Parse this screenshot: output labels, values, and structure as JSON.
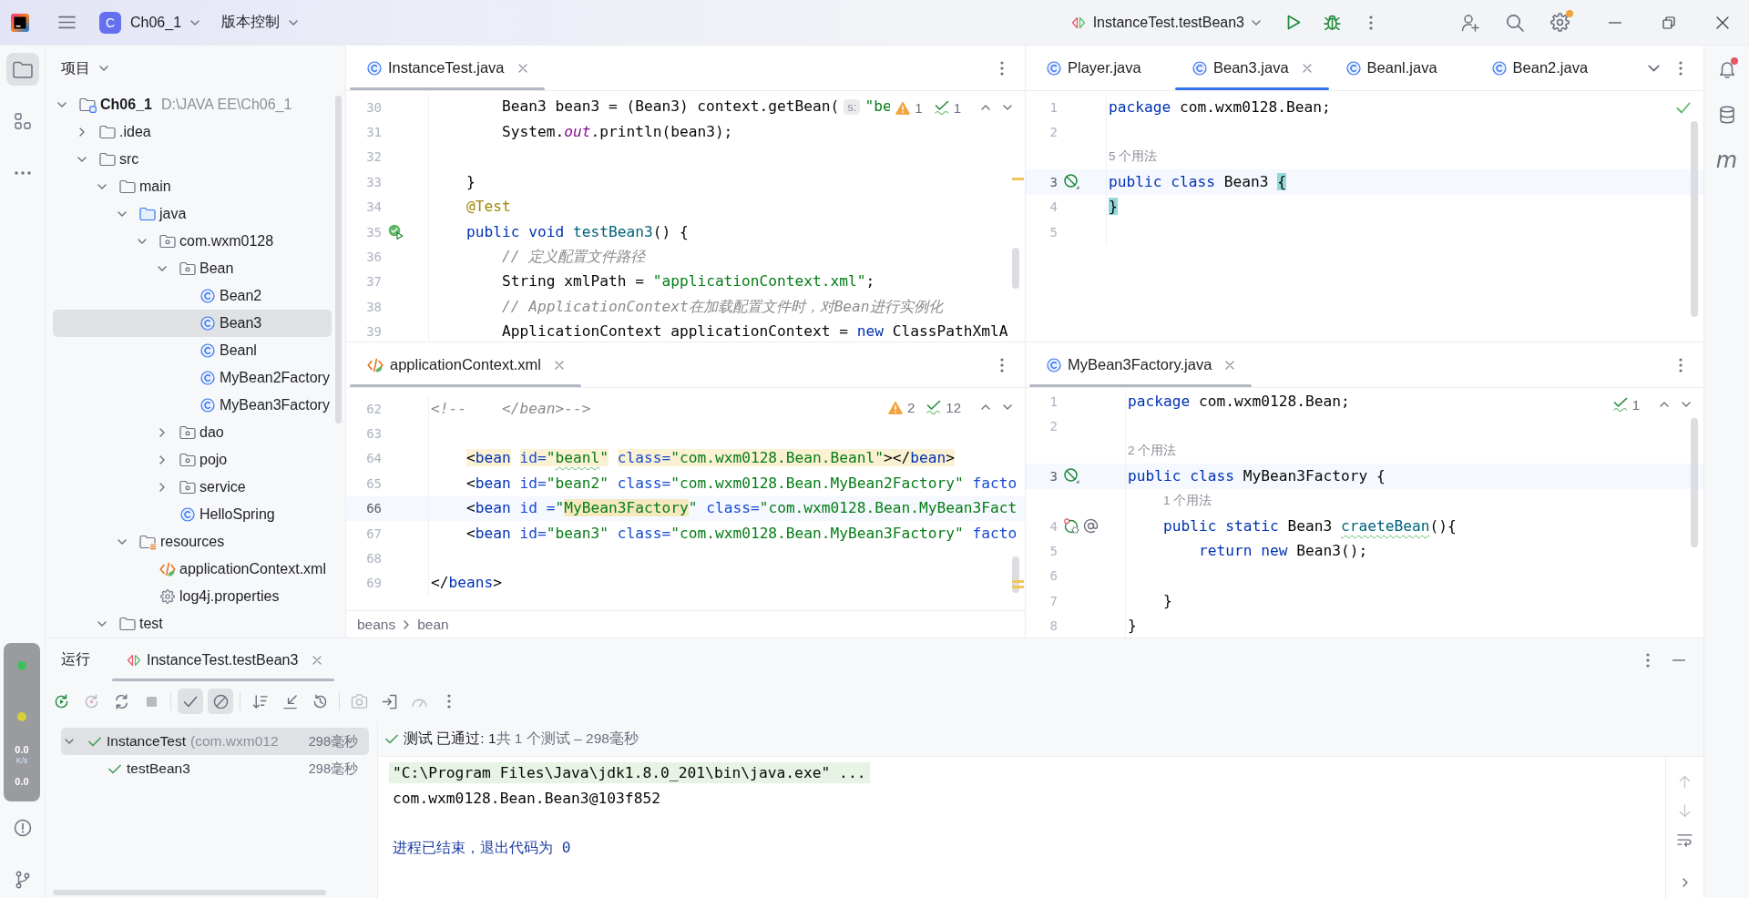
{
  "title_bar": {
    "project_badge": "C",
    "project": "Ch06_1",
    "vcs": "版本控制",
    "run_config": "InstanceTest.testBean3",
    "settings_badge": true
  },
  "tool_strip": {
    "top": [
      {
        "kind": "project",
        "selected": true
      },
      {
        "kind": "structure",
        "selected": false
      },
      {
        "kind": "more",
        "selected": false
      }
    ],
    "bottom": [
      {
        "kind": "problems",
        "selected": false
      },
      {
        "kind": "git",
        "selected": false
      }
    ]
  },
  "speed_widget": {
    "readings": [
      {
        "value": "0.0",
        "unit": "K/s"
      },
      {
        "value": "0.0"
      }
    ]
  },
  "project_panel": {
    "title": "项目",
    "tree": [
      {
        "kind": "module",
        "label": "Ch06_1",
        "hint": "D:\\JAVA EE\\Ch06_1",
        "expanded": true,
        "selected": false,
        "children": [
          {
            "kind": "folder",
            "label": ".idea",
            "expanded": false,
            "selected": false
          },
          {
            "kind": "folder",
            "label": "src",
            "expanded": true,
            "selected": false,
            "children": [
              {
                "kind": "folder",
                "label": "main",
                "expanded": true,
                "selected": false,
                "children": [
                  {
                    "kind": "source",
                    "label": "java",
                    "expanded": true,
                    "selected": false,
                    "children": [
                      {
                        "kind": "package",
                        "label": "com.wxm0128",
                        "expanded": true,
                        "selected": false,
                        "children": [
                          {
                            "kind": "package",
                            "label": "Bean",
                            "expanded": true,
                            "selected": false,
                            "children": [
                              {
                                "kind": "class",
                                "label": "Bean2",
                                "selected": false
                              },
                              {
                                "kind": "class",
                                "label": "Bean3",
                                "selected": true
                              },
                              {
                                "kind": "class",
                                "label": "Beanl",
                                "selected": false
                              },
                              {
                                "kind": "class",
                                "label": "MyBean2Factory",
                                "selected": false
                              },
                              {
                                "kind": "class",
                                "label": "MyBean3Factory",
                                "selected": false
                              }
                            ]
                          },
                          {
                            "kind": "package",
                            "label": "dao",
                            "expanded": false,
                            "selected": false
                          },
                          {
                            "kind": "package",
                            "label": "pojo",
                            "expanded": false,
                            "selected": false
                          },
                          {
                            "kind": "package",
                            "label": "service",
                            "expanded": false,
                            "selected": false
                          },
                          {
                            "kind": "class",
                            "label": "HelloSpring",
                            "selected": false
                          }
                        ]
                      }
                    ]
                  },
                  {
                    "kind": "resources",
                    "label": "resources",
                    "expanded": true,
                    "selected": false,
                    "children": [
                      {
                        "kind": "xml",
                        "label": "applicationContext.xml",
                        "selected": false
                      },
                      {
                        "kind": "properties",
                        "label": "log4j.properties",
                        "selected": false
                      }
                    ]
                  }
                ]
              },
              {
                "kind": "folder",
                "label": "test",
                "expanded": true,
                "selected": false
              }
            ]
          }
        ]
      }
    ]
  },
  "editors": [
    {
      "active": false,
      "navigation": true,
      "tabs": [
        {
          "kind": "class",
          "label": "InstanceTest.java",
          "selected": true
        }
      ],
      "inspections": [
        {
          "kind": "warning",
          "count": "1"
        },
        {
          "kind": "weak",
          "count": "1"
        }
      ],
      "lines": [
        {
          "kind": "code",
          "number": "30",
          "current": false,
          "tokens": [
            {
              "kind": "plain",
              "text": "        Bean3 bean3 = (Bean3) context.getBean("
            },
            {
              "kind": "inlay",
              "text": "s:"
            },
            {
              "kind": "string",
              "text": "\"be"
            }
          ]
        },
        {
          "kind": "code",
          "number": "31",
          "current": false,
          "tokens": [
            {
              "kind": "plain",
              "text": "        System."
            },
            {
              "kind": "field",
              "text": "out"
            },
            {
              "kind": "plain",
              "text": ".println(bean3);"
            }
          ]
        },
        {
          "kind": "code",
          "number": "32",
          "current": false
        },
        {
          "kind": "code",
          "number": "33",
          "current": false,
          "tokens": [
            {
              "kind": "plain",
              "text": "    }"
            }
          ]
        },
        {
          "kind": "code",
          "number": "34",
          "current": false,
          "tokens": [
            {
              "kind": "annotation",
              "text": "    @Test"
            }
          ]
        },
        {
          "kind": "code",
          "number": "35",
          "current": false,
          "gutter": [
            {
              "kind": "run"
            }
          ],
          "tokens": [
            {
              "kind": "keyword",
              "text": "    public void "
            },
            {
              "kind": "decl",
              "text": "testBean3"
            },
            {
              "kind": "plain",
              "text": "() {"
            }
          ]
        },
        {
          "kind": "code",
          "number": "36",
          "current": false,
          "tokens": [
            {
              "kind": "comment",
              "text": "        // 定义配置文件路径"
            }
          ]
        },
        {
          "kind": "code",
          "number": "37",
          "current": false,
          "tokens": [
            {
              "kind": "plain",
              "text": "        String xmlPath = "
            },
            {
              "kind": "string",
              "text": "\"applicationContext.xml\""
            },
            {
              "kind": "plain",
              "text": ";"
            }
          ]
        },
        {
          "kind": "code",
          "number": "38",
          "current": false,
          "tokens": [
            {
              "kind": "comment",
              "text": "        // ApplicationContext在加载配置文件时，对Bean进行实例化"
            }
          ]
        },
        {
          "kind": "code",
          "number": "39",
          "current": false,
          "tokens": [
            {
              "kind": "plain",
              "text": "        ApplicationContext applicationContext = "
            },
            {
              "kind": "keyword",
              "text": "new"
            },
            {
              "kind": "plain",
              "text": " ClassPathXmlA"
            }
          ]
        }
      ]
    },
    {
      "active": true,
      "overflow_menu": true,
      "tabs": [
        {
          "kind": "class",
          "label": "Player.java",
          "selected": false
        },
        {
          "kind": "class",
          "label": "Bean3.java",
          "selected": true
        },
        {
          "kind": "class",
          "label": "Beanl.java",
          "selected": false
        },
        {
          "kind": "class",
          "label": "Bean2.java",
          "selected": false
        }
      ],
      "inspections": [
        {
          "kind": "ok"
        }
      ],
      "lines": [
        {
          "kind": "code",
          "number": "1",
          "current": false,
          "tokens": [
            {
              "kind": "keyword",
              "text": "package"
            },
            {
              "kind": "plain",
              "text": " com.wxm0128.Bean;"
            }
          ]
        },
        {
          "kind": "code",
          "number": "2",
          "current": false
        },
        {
          "kind": "usages",
          "text": "5 个用法",
          "nested": false
        },
        {
          "kind": "code",
          "number": "3",
          "current": true,
          "gutter": [
            {
              "kind": "bean"
            }
          ],
          "tokens": [
            {
              "kind": "keyword",
              "text": "public class "
            },
            {
              "kind": "plain",
              "text": "Bean3 "
            },
            {
              "kind": "brace",
              "text": "{"
            }
          ]
        },
        {
          "kind": "code",
          "number": "4",
          "current": false,
          "tokens": [
            {
              "kind": "brace",
              "text": "}"
            }
          ]
        },
        {
          "kind": "code",
          "number": "5",
          "current": false
        }
      ]
    },
    {
      "active": false,
      "navigation": true,
      "tabs": [
        {
          "kind": "xml",
          "label": "applicationContext.xml",
          "selected": true
        }
      ],
      "inspections": [
        {
          "kind": "warning",
          "count": "2"
        },
        {
          "kind": "weak",
          "count": "12"
        }
      ],
      "breadcrumbs": [
        "beans",
        "bean"
      ],
      "lines": [
        {
          "kind": "code",
          "number": "62",
          "current": false,
          "tokens": [
            {
              "kind": "comment",
              "text": "<!--    </bean>-->"
            }
          ]
        },
        {
          "kind": "code",
          "number": "63",
          "current": false
        },
        {
          "kind": "code",
          "number": "64",
          "current": false,
          "marked": true,
          "tokens": [
            {
              "kind": "plain",
              "text": "    <"
            },
            {
              "kind": "tag",
              "text": "bean"
            },
            {
              "kind": "attr",
              "text": " id="
            },
            {
              "kind": "value",
              "text": "\""
            },
            {
              "kind": "value_typo",
              "text": "beanl"
            },
            {
              "kind": "value",
              "text": "\""
            },
            {
              "kind": "attr",
              "text": " class="
            },
            {
              "kind": "value",
              "text": "\"com.wxm0128.Bean.Beanl\""
            },
            {
              "kind": "plain",
              "text": "></"
            },
            {
              "kind": "tag",
              "text": "bean"
            },
            {
              "kind": "plain",
              "text": ">"
            }
          ]
        },
        {
          "kind": "code",
          "number": "65",
          "current": false,
          "tokens": [
            {
              "kind": "plain",
              "text": "    <"
            },
            {
              "kind": "tag",
              "text": "bean"
            },
            {
              "kind": "attr",
              "text": " id="
            },
            {
              "kind": "value",
              "text": "\"bean2\""
            },
            {
              "kind": "attr",
              "text": " class="
            },
            {
              "kind": "value",
              "text": "\"com.wxm0128.Bean.MyBean2Factory\""
            },
            {
              "kind": "attr",
              "text": " facto"
            }
          ]
        },
        {
          "kind": "code",
          "number": "66",
          "current": true,
          "tokens": [
            {
              "kind": "plain",
              "text": "    <"
            },
            {
              "kind": "tag",
              "text": "bean"
            },
            {
              "kind": "attr",
              "text": " id ="
            },
            {
              "kind": "value",
              "text": "\""
            },
            {
              "kind": "match",
              "text": "MyBean3Factory"
            },
            {
              "kind": "value",
              "text": "\""
            },
            {
              "kind": "attr",
              "text": " class="
            },
            {
              "kind": "value",
              "text": "\"com.wxm0128.Bean.MyBean3Fact"
            }
          ]
        },
        {
          "kind": "code",
          "number": "67",
          "current": false,
          "tokens": [
            {
              "kind": "plain",
              "text": "    <"
            },
            {
              "kind": "tag",
              "text": "bean"
            },
            {
              "kind": "attr",
              "text": " id="
            },
            {
              "kind": "value",
              "text": "\"bean3\""
            },
            {
              "kind": "attr",
              "text": " class="
            },
            {
              "kind": "value",
              "text": "\"com.wxm0128.Bean.MyBean3Factory\""
            },
            {
              "kind": "attr",
              "text": " facto"
            }
          ]
        },
        {
          "kind": "code",
          "number": "68",
          "current": false
        },
        {
          "kind": "code",
          "number": "69",
          "current": false,
          "tokens": [
            {
              "kind": "plain",
              "text": "</"
            },
            {
              "kind": "tag",
              "text": "beans"
            },
            {
              "kind": "plain",
              "text": ">"
            }
          ]
        }
      ]
    },
    {
      "active": false,
      "navigation": true,
      "tabs": [
        {
          "kind": "class",
          "label": "MyBean3Factory.java",
          "selected": true
        }
      ],
      "inspections": [
        {
          "kind": "weak",
          "count": "1"
        }
      ],
      "lines": [
        {
          "kind": "code",
          "number": "1",
          "current": false,
          "tokens": [
            {
              "kind": "keyword",
              "text": "package"
            },
            {
              "kind": "plain",
              "text": " com.wxm0128.Bean;"
            }
          ]
        },
        {
          "kind": "code",
          "number": "2",
          "current": false
        },
        {
          "kind": "usages",
          "text": "2 个用法",
          "nested": false
        },
        {
          "kind": "code",
          "number": "3",
          "current": true,
          "gutter": [
            {
              "kind": "bean"
            }
          ],
          "tokens": [
            {
              "kind": "keyword",
              "text": "public class "
            },
            {
              "kind": "plain",
              "text": "MyBean3Factory {"
            }
          ]
        },
        {
          "kind": "usages",
          "text": "1 个用法",
          "nested": true
        },
        {
          "kind": "code",
          "number": "4",
          "current": false,
          "gutter": [
            {
              "kind": "factory"
            },
            {
              "kind": "autowired"
            }
          ],
          "tokens": [
            {
              "kind": "keyword",
              "text": "    public static "
            },
            {
              "kind": "plain",
              "text": "Bean3 "
            },
            {
              "kind": "decl_typo",
              "text": "craeteBean"
            },
            {
              "kind": "plain",
              "text": "(){"
            }
          ]
        },
        {
          "kind": "code",
          "number": "5",
          "current": false,
          "tokens": [
            {
              "kind": "keyword",
              "text": "        return new "
            },
            {
              "kind": "plain",
              "text": "Bean3();"
            }
          ]
        },
        {
          "kind": "code",
          "number": "6",
          "current": false
        },
        {
          "kind": "code",
          "number": "7",
          "current": false,
          "tokens": [
            {
              "kind": "plain",
              "text": "    }"
            }
          ]
        },
        {
          "kind": "code",
          "number": "8",
          "current": false,
          "tokens": [
            {
              "kind": "plain",
              "text": "}"
            }
          ]
        }
      ]
    }
  ],
  "right_strip": [
    {
      "kind": "notifications",
      "badge": true
    },
    {
      "kind": "database"
    },
    {
      "kind": "maven",
      "label": "m"
    }
  ],
  "run_panel": {
    "title": "运行",
    "tabs": [
      {
        "label": "InstanceTest.testBean3",
        "selected": true
      }
    ],
    "toolbar": [
      {
        "buttons": [
          {
            "kind": "rerun",
            "selected": false,
            "disabled": false
          },
          {
            "kind": "rerun_failed",
            "selected": false,
            "disabled": true
          },
          {
            "kind": "toggle_auto",
            "selected": false,
            "disabled": false
          },
          {
            "kind": "stop",
            "selected": false,
            "disabled": true
          }
        ]
      },
      {
        "buttons": [
          {
            "kind": "show_passed",
            "selected": true,
            "disabled": false
          },
          {
            "kind": "show_ignored",
            "selected": true,
            "disabled": false
          }
        ]
      },
      {
        "buttons": [
          {
            "kind": "sort",
            "selected": false,
            "disabled": false
          },
          {
            "kind": "collapse",
            "selected": false,
            "disabled": false
          },
          {
            "kind": "history",
            "selected": false,
            "disabled": false
          }
        ]
      },
      {
        "buttons": [
          {
            "kind": "screenshot",
            "selected": false,
            "disabled": true
          },
          {
            "kind": "import",
            "selected": false,
            "disabled": false
          },
          {
            "kind": "coverage",
            "selected": false,
            "disabled": true
          },
          {
            "kind": "more",
            "selected": false,
            "disabled": false
          }
        ]
      }
    ],
    "tests": [
      {
        "label": "InstanceTest",
        "detail": "(com.wxm012",
        "duration": "298毫秒",
        "passed": true,
        "selected": true,
        "expanded": true,
        "children": [
          {
            "label": "testBean3",
            "duration": "298毫秒",
            "passed": true,
            "selected": false
          }
        ]
      }
    ],
    "status": {
      "passed": true,
      "summary": "测试 已通过: 1",
      "detail": "共 1 个测试 – 298毫秒"
    },
    "console": [
      {
        "kind": "command",
        "text": "\"C:\\Program Files\\Java\\jdk1.8.0_201\\bin\\java.exe\" ..."
      },
      {
        "kind": "output",
        "text": "com.wxm0128.Bean.Bean3@103f852"
      },
      {
        "kind": "blank"
      },
      {
        "kind": "system",
        "text": "进程已结束，退出代码为 0"
      }
    ],
    "console_actions": [
      {
        "kind": "up",
        "disabled": true
      },
      {
        "kind": "down",
        "disabled": true
      },
      {
        "kind": "wrap",
        "disabled": false
      },
      {
        "kind": "expand",
        "disabled": false
      }
    ]
  }
}
